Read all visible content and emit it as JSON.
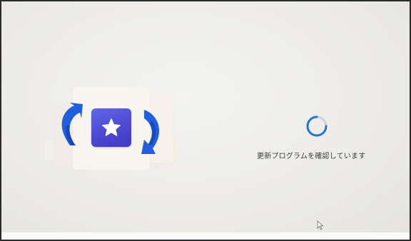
{
  "status": {
    "message": "更新プログラムを確認しています"
  },
  "icons": {
    "illustration": "update-refresh-arrows-with-star-app-icon",
    "spinner": "loading-spinner-icon",
    "cursor": "mouse-pointer-icon"
  },
  "colors": {
    "background": "#ecebe8",
    "spinner_ring": "#c9d3df",
    "spinner_accent": "#2a74c9",
    "arrow_blue": "#1f5fe0",
    "tile_purple": "#4f4cd6"
  }
}
